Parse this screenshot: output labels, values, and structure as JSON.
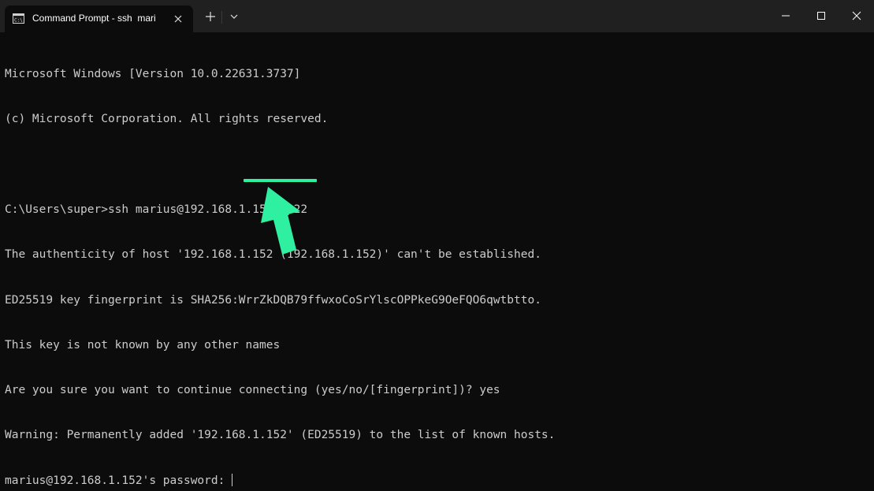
{
  "window": {
    "tab_title": "Command Prompt - ssh  mari",
    "tab_icon": "command-prompt-icon"
  },
  "titlebar": {
    "new_tab_icon": "plus-icon",
    "dropdown_icon": "chevron-down-icon",
    "minimize_icon": "minimize-icon",
    "maximize_icon": "maximize-icon",
    "close_icon": "close-icon"
  },
  "terminal": {
    "lines": [
      "Microsoft Windows [Version 10.0.22631.3737]",
      "(c) Microsoft Corporation. All rights reserved.",
      "",
      "C:\\Users\\super>ssh marius@192.168.1.152 -p22",
      "The authenticity of host '192.168.1.152 (192.168.1.152)' can't be established.",
      "ED25519 key fingerprint is SHA256:WrrZkDQB79ffwxoCoSrYlscOPPkeG9OeFQO6qwtbtto.",
      "This key is not known by any other names",
      "Are you sure you want to continue connecting (yes/no/[fingerprint])? yes",
      "Warning: Permanently added '192.168.1.152' (ED25519) to the list of known hosts.",
      "marius@192.168.1.152's password: "
    ]
  },
  "annotation": {
    "color": "#2ef0a0",
    "icon": "arrow-up-icon"
  },
  "colors": {
    "background": "#0c0c0c",
    "titlebar": "#202020",
    "text": "#cccccc"
  }
}
